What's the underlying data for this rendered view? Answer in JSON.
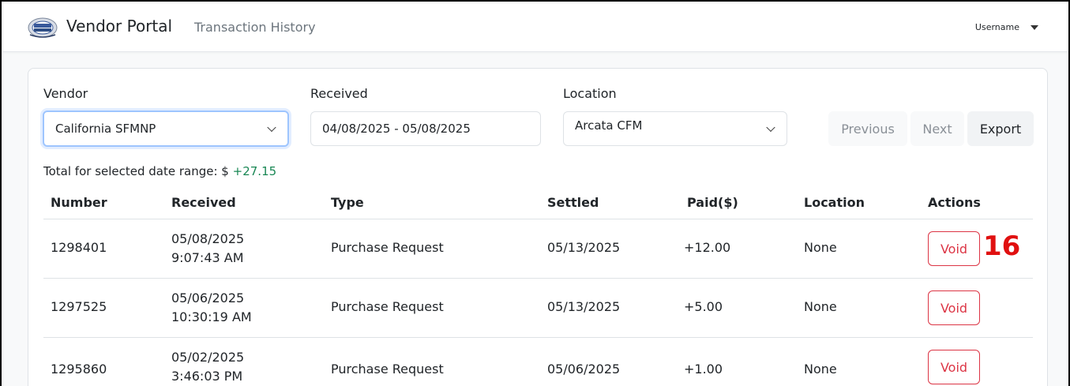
{
  "header": {
    "brand": "Vendor Portal",
    "page_title": "Transaction History",
    "username": "Username"
  },
  "filters": {
    "vendor_label": "Vendor",
    "vendor_value": "California SFMNP",
    "received_label": "Received",
    "received_value": "04/08/2025 - 05/08/2025",
    "location_label": "Location",
    "location_value": "Arcata CFM"
  },
  "pagination": {
    "previous": "Previous",
    "next": "Next",
    "export": "Export"
  },
  "total": {
    "label": "Total for selected date range: $",
    "value": "+27.15"
  },
  "table": {
    "columns": [
      "Number",
      "Received",
      "Type",
      "Settled",
      "Paid($)",
      "Location",
      "Actions"
    ],
    "rows": [
      {
        "number": "1298401",
        "received_date": "05/08/2025",
        "received_time": "9:07:43 AM",
        "type": "Purchase Request",
        "settled": "05/13/2025",
        "paid": "+12.00",
        "location": "None",
        "action": "Void"
      },
      {
        "number": "1297525",
        "received_date": "05/06/2025",
        "received_time": "10:30:19 AM",
        "type": "Purchase Request",
        "settled": "05/13/2025",
        "paid": "+5.00",
        "location": "None",
        "action": "Void"
      },
      {
        "number": "1295860",
        "received_date": "05/02/2025",
        "received_time": "3:46:03 PM",
        "type": "Purchase Request",
        "settled": "05/06/2025",
        "paid": "+1.00",
        "location": "None",
        "action": "Void"
      }
    ]
  },
  "annotation": "16",
  "colors": {
    "accent_green": "#198754",
    "void_red": "#dc3545",
    "annotation_red": "#e01010",
    "focus_blue": "#9ec5fe"
  },
  "icons": {
    "logo": "wic-direct-logo",
    "user_caret": "caret-down-icon",
    "select_chevron": "chevron-down-icon"
  }
}
